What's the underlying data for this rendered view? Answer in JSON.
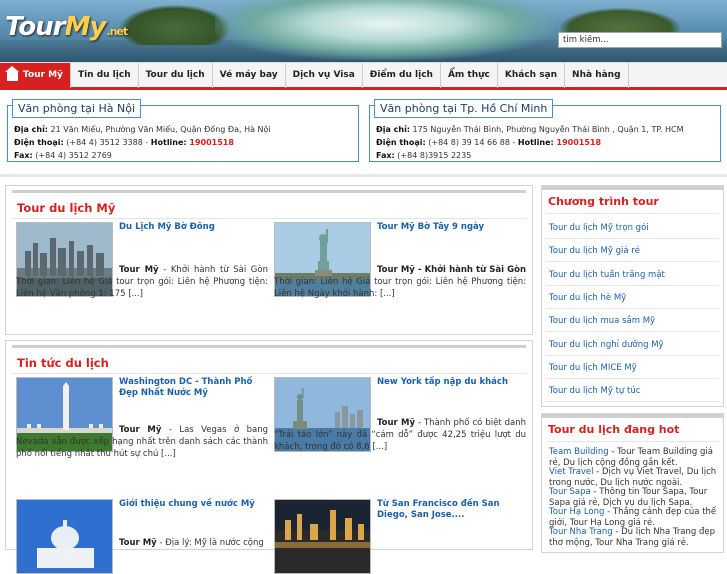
{
  "header": {
    "logo_main": "Tour",
    "logo_my": "My",
    "logo_net": ".net",
    "search_placeholder": "tìm kiếm..."
  },
  "nav": {
    "items": [
      {
        "label": "Tour Mỹ",
        "active": true
      },
      {
        "label": "Tin du lịch"
      },
      {
        "label": "Tour du lịch"
      },
      {
        "label": "Vé máy bay"
      },
      {
        "label": "Dịch vụ Visa"
      },
      {
        "label": "Điểm du lịch"
      },
      {
        "label": "Ẩm thực"
      },
      {
        "label": "Khách sạn"
      },
      {
        "label": "Nhà hàng"
      }
    ]
  },
  "offices": [
    {
      "title": "Văn phòng tại Hà Nội",
      "address_label": "Địa chỉ:",
      "address": " 21 Văn Miếu, Phường Văn Miếu, Quận Đống Đa, Hà Nội",
      "phone_label": "Điện thoại:",
      "phone": " (+84 4) 3512 3388 - ",
      "hotline_label": "Hotline:",
      "hotline": " 19001518",
      "fax_label": "Fax:",
      "fax": " (+84 4) 3512 2769"
    },
    {
      "title": "Văn phòng tại Tp. Hồ Chí Minh",
      "address_label": "Địa chỉ:",
      "address": " 175 Nguyễn Thái Bình, Phường Nguyễn Thái Bình , Quận 1, TP. HCM",
      "phone_label": "Điện thoại:",
      "phone": " (+84 8) 39 14 66 88 - ",
      "hotline_label": "Hotline:",
      "hotline": " 19001518",
      "fax_label": "Fax:",
      "fax": " (+84 8)3915 2235"
    }
  ],
  "tour_section": {
    "title": "Tour du lịch Mỹ",
    "cards": [
      {
        "title": "Du Lịch Mỹ Bờ Đông",
        "brand": "Tour Mỹ",
        "desc": " - Khởi hành từ Sài Gòn Thời gian: Liên hệ Giá tour trọn gói: Liên hệ Phương tiện: Liên hệ Văn phòng 1: 175 [...]"
      },
      {
        "title": "Tour Mỹ Bờ Tây 9 ngày",
        "brand": "Tour Mỹ",
        "desc_bold": " - Khởi hành từ Sài Gòn",
        "desc": " Thời gian: Liên hệ Giá tour trọn gói: Liên hệ Phương tiện: Liên hệ Ngày khởi hành: [...]"
      }
    ]
  },
  "news_section": {
    "title": "Tin tức du lịch",
    "cards": [
      {
        "title": "Washington DC - Thành Phố Đẹp Nhất Nước Mỹ",
        "brand": "Tour Mỹ",
        "desc": " - Las Vegas ở bang Nevada vẫn được xếp hạng nhất trên danh sách các thành phố nổi tiếng nhất thu hút sự chú [...]"
      },
      {
        "title": "New York tấp nập du khách",
        "brand": "Tour Mỹ",
        "desc": " - Thành phố có biệt danh “Trái táo lớn” này đã “cám dỗ” được 42,25 triệu lượt du khách, trong đó có 8,6 [...]"
      },
      {
        "title": "Giới thiệu chung về nước Mỹ",
        "brand": "Tour Mỹ",
        "desc": " - Địa lý: Mỹ là nước cộng"
      },
      {
        "title": "Từ San Francisco đến San Diego, San Jose....",
        "brand": "",
        "desc": ""
      }
    ]
  },
  "sidebar": {
    "program_title": "Chương trình tour",
    "program_links": [
      "Tour du lịch Mỹ trọn gói",
      "Tour du lịch Mỹ giá rẻ",
      "Tour du lịch tuần trăng mật",
      "Tour du lịch hè Mỹ",
      "Tour du lịch mua sắm Mỹ",
      "Tour du lịch nghỉ dưỡng Mỹ",
      "Tour du lịch MICE Mỹ",
      "Tour du lịch Mỹ tự túc"
    ],
    "hot_title": "Tour du lịch đang hot",
    "hot_items": [
      {
        "link": "Team Building",
        "text": " - Tour Team Building giá rẻ, Du lịch cộng đồng gắn kết."
      },
      {
        "link": "Viet Travel",
        "text": " - Dịch vụ Viet Travel, Du lịch trong nước, Du lịch nước ngoài."
      },
      {
        "link": "Tour Sapa",
        "text": " - Thông tin Tour Sapa, Tour Sapa giá rẻ, Dịch vụ du lịch Sapa."
      },
      {
        "link": "Tour Hạ Long",
        "text": " - Thắng cảnh đẹp của thế giới, Tour Hạ Long giá rẻ."
      },
      {
        "link": "Tour Nha Trang",
        "text": " - Du lịch Nha Trang đẹp thơ mộng, Tour Nha Trang giá rẻ."
      }
    ]
  }
}
